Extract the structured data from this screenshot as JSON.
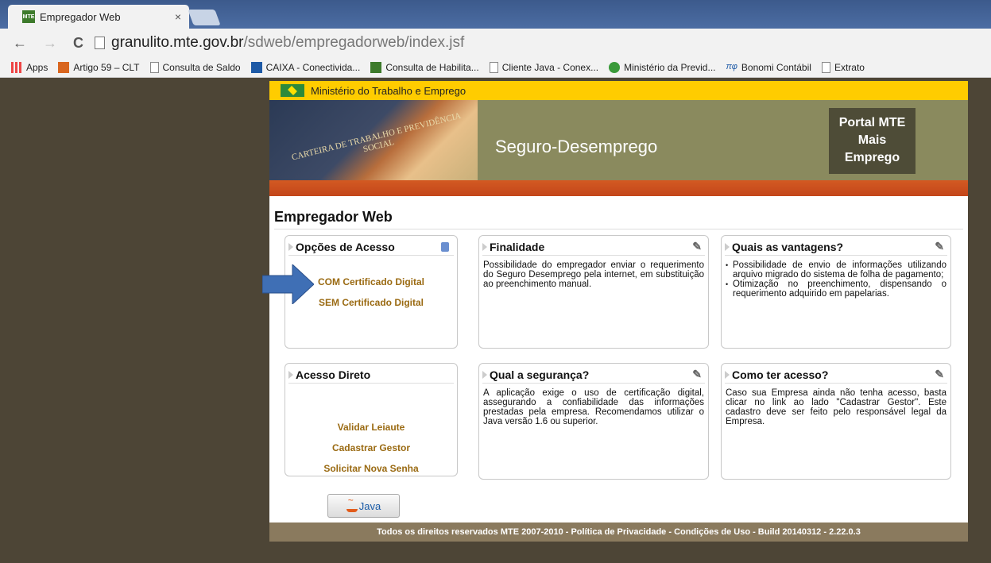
{
  "browser": {
    "tab_title": "Empregador Web",
    "tab_close": "×",
    "tab_favicon": "MTE",
    "url_host": "granulito.mte.gov.br",
    "url_path": "/sdweb/empregadorweb/index.jsf",
    "nav": {
      "back": "←",
      "forward": "→",
      "reload": "C"
    }
  },
  "bookmarks": [
    {
      "label": "Apps",
      "icon": "apps-icon"
    },
    {
      "label": "Artigo 59 – CLT",
      "icon": "bookmark-icon"
    },
    {
      "label": "Consulta de Saldo",
      "icon": "page-icon"
    },
    {
      "label": "CAIXA - Conectivida...",
      "icon": "caixa-icon"
    },
    {
      "label": "Consulta de Habilita...",
      "icon": "mte-icon"
    },
    {
      "label": "Cliente Java - Conex...",
      "icon": "page-icon"
    },
    {
      "label": "Ministério da Previd...",
      "icon": "previdencia-icon"
    },
    {
      "label": "Bonomi Contábil",
      "icon": "pi-icon"
    },
    {
      "label": "Extrato",
      "icon": "page-icon"
    }
  ],
  "header": {
    "ministry": "Ministério do Trabalho e Emprego",
    "banner_title": "Seguro-Desemprego",
    "ctps_text": "CARTEIRA DE TRABALHO E PREVIDÊNCIA SOCIAL",
    "portal_line1": "Portal MTE",
    "portal_line2": "Mais",
    "portal_line3": "Emprego"
  },
  "main": {
    "page_title": "Empregador Web",
    "panels": {
      "opcoes": {
        "title": "Opções de Acesso",
        "links": [
          "COM Certificado Digital",
          "SEM Certificado Digital"
        ]
      },
      "finalidade": {
        "title": "Finalidade",
        "text": "Possibilidade do empregador enviar o requerimento do Seguro Desemprego pela internet, em substituição ao preenchimento manual."
      },
      "vantagens": {
        "title": "Quais as vantagens?",
        "items": [
          "Possibilidade de envio de informações utilizando arquivo migrado do sistema de folha de pagamento;",
          "Otimização no preenchimento, dispensando o requerimento adquirido em papelarias."
        ]
      },
      "acesso_direto": {
        "title": "Acesso Direto",
        "links": [
          "Validar Leiaute",
          "Cadastrar Gestor",
          "Solicitar Nova Senha"
        ]
      },
      "seguranca": {
        "title": "Qual a segurança?",
        "text": "A aplicação exige o uso de certificação digital, assegurando a confiabilidade das informações prestadas pela empresa. Recomendamos utilizar o Java versão 1.6 ou superior."
      },
      "como_acesso": {
        "title": "Como ter acesso?",
        "text": "Caso sua Empresa ainda não tenha acesso, basta clicar no link ao lado \"Cadastrar Gestor\". Este cadastro deve ser feito pelo responsável legal da Empresa."
      }
    },
    "java_button": "Java",
    "footer": "Todos os direitos reservados MTE 2007-2010 - Política de Privacidade - Condições de Uso - Build 20140312 - 2.22.0.3"
  },
  "colors": {
    "accent_yellow": "#ffcc00",
    "banner": "#8a8a5e",
    "orange_strip": "#d35a22",
    "link": "#9a6a12",
    "arrow": "#3f6fb5",
    "backdrop": "#4d4536"
  }
}
